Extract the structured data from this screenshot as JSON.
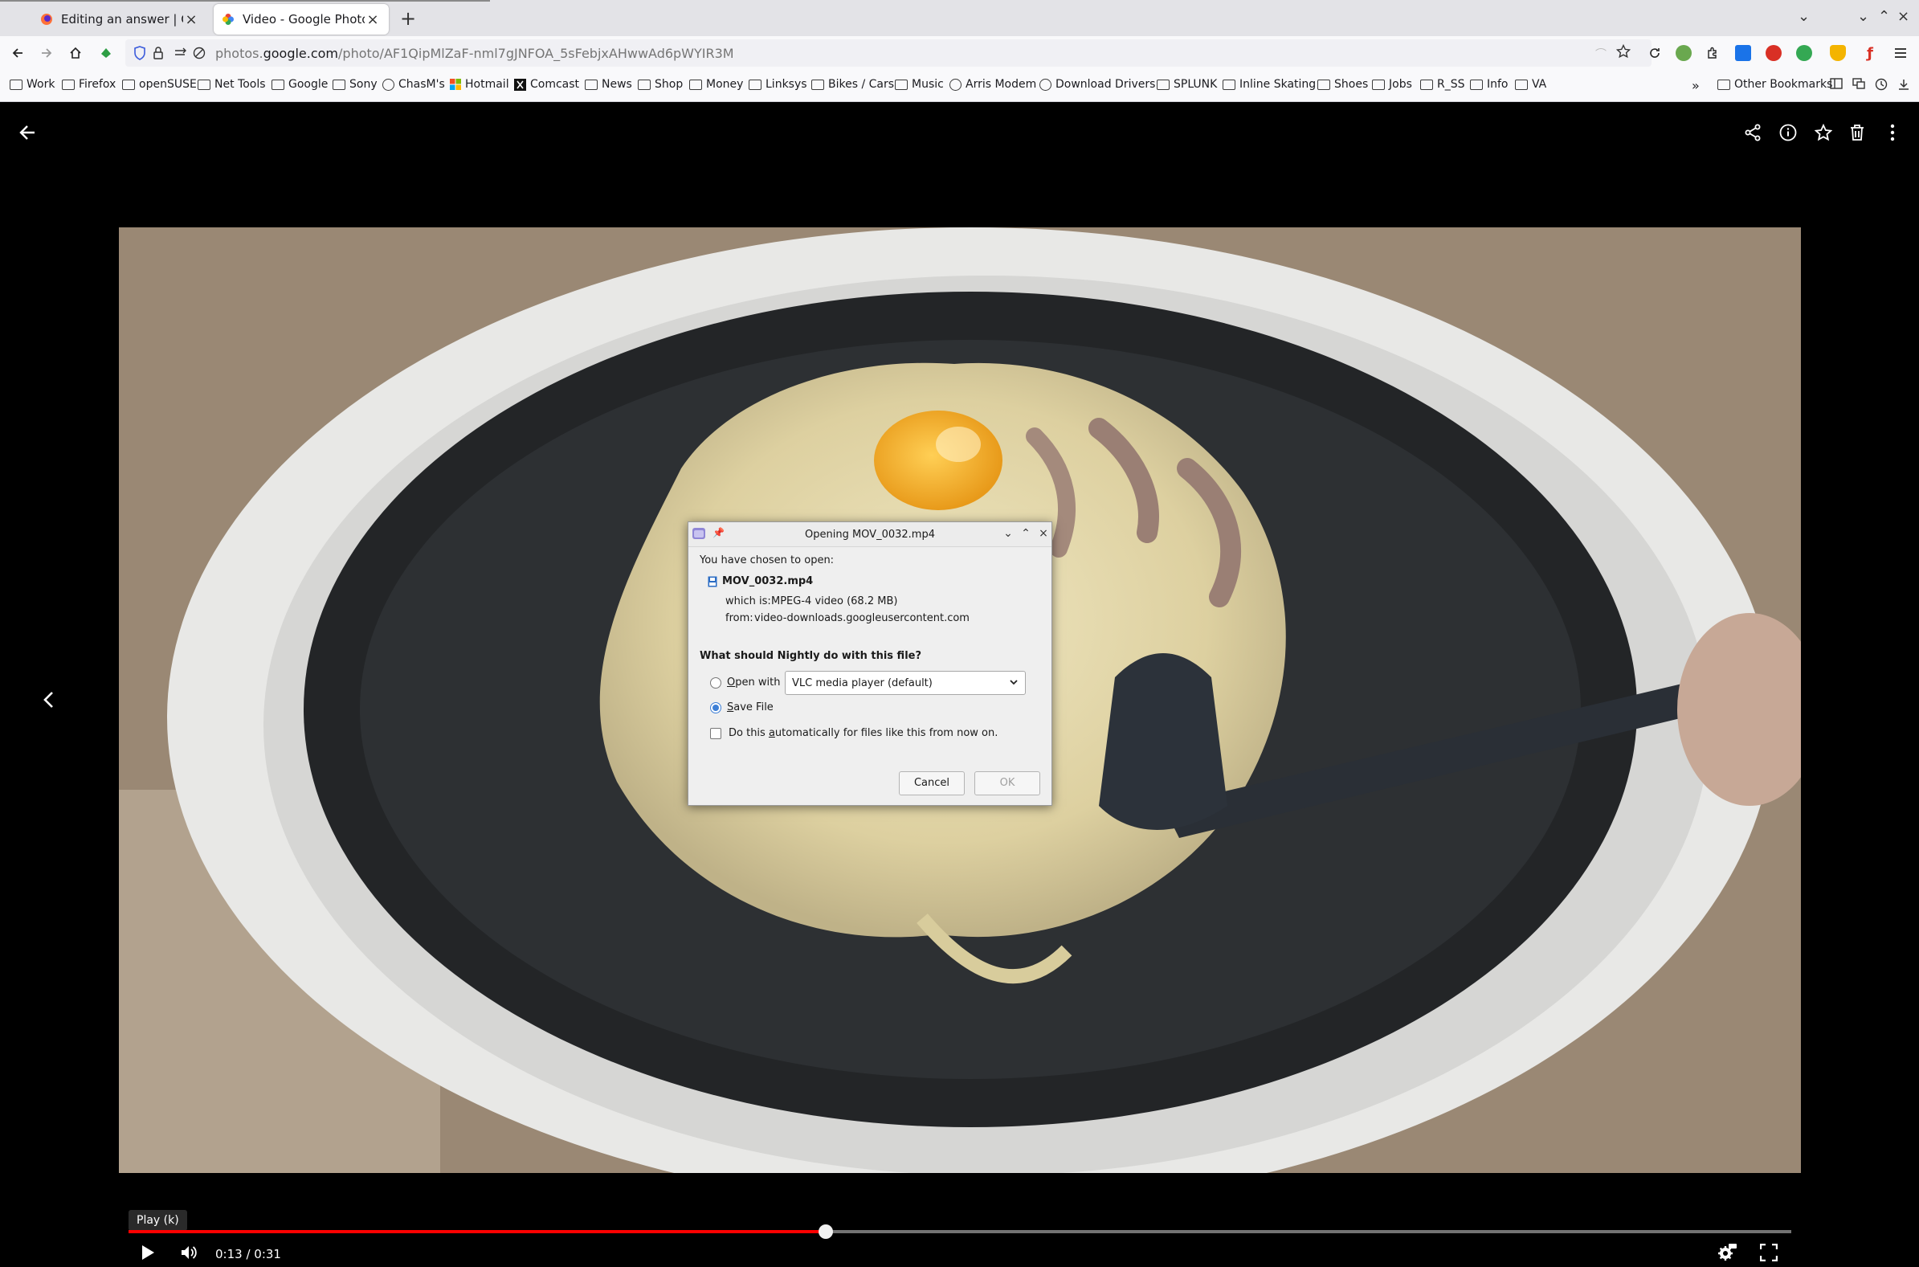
{
  "browser": {
    "tabs": [
      {
        "title": "Editing an answer | Can't d",
        "active": false
      },
      {
        "title": "Video - Google Photos",
        "active": true
      }
    ],
    "url": {
      "prefix": "photos.",
      "host": "google.com",
      "path": "/photo/AF1QipMlZaF-nml7gJNFOA_5sFebjxAHwwAd6pWYIR3M"
    },
    "bookmarks": [
      {
        "label": "Work",
        "icon": "folder-icon"
      },
      {
        "label": "Firefox",
        "icon": "folder-icon"
      },
      {
        "label": "openSUSE",
        "icon": "folder-icon"
      },
      {
        "label": "Net Tools",
        "icon": "folder-icon"
      },
      {
        "label": "Google",
        "icon": "folder-icon"
      },
      {
        "label": "Sony",
        "icon": "folder-icon"
      },
      {
        "label": "ChasM's",
        "icon": "globe-icon"
      },
      {
        "label": "Hotmail",
        "icon": "microsoft-icon"
      },
      {
        "label": "Comcast",
        "icon": "x-icon"
      },
      {
        "label": "News",
        "icon": "folder-icon"
      },
      {
        "label": "Shop",
        "icon": "folder-icon"
      },
      {
        "label": "Money",
        "icon": "folder-icon"
      },
      {
        "label": "Linksys",
        "icon": "folder-icon"
      },
      {
        "label": "Bikes / Cars",
        "icon": "folder-icon"
      },
      {
        "label": "Music",
        "icon": "folder-icon"
      },
      {
        "label": "Arris Modem",
        "icon": "globe-icon"
      },
      {
        "label": "Download Drivers",
        "icon": "globe-icon"
      },
      {
        "label": "SPLUNK",
        "icon": "folder-icon"
      },
      {
        "label": "Inline Skating",
        "icon": "folder-icon"
      },
      {
        "label": "Shoes",
        "icon": "folder-icon"
      },
      {
        "label": "Jobs",
        "icon": "folder-icon"
      },
      {
        "label": "R_SS",
        "icon": "folder-icon"
      },
      {
        "label": "Info",
        "icon": "folder-icon"
      },
      {
        "label": "VA",
        "icon": "folder-icon"
      }
    ],
    "other_bookmarks": "Other Bookmarks"
  },
  "player": {
    "tooltip": "Play (k)",
    "time": "0:13 / 0:31",
    "progress_fraction": 0.4194
  },
  "dialog": {
    "title": "Opening MOV_0032.mp4",
    "intro": "You have chosen to open:",
    "filename": "MOV_0032.mp4",
    "which_is_label": "which is:",
    "which_is_value": "MPEG-4 video (68.2 MB)",
    "from_label": "from:",
    "from_value": "video-downloads.googleusercontent.com",
    "question": "What should Nightly do with this file?",
    "open_with_key": "O",
    "open_with_rest": "pen with",
    "open_with_app": "VLC media player (default)",
    "save_key": "S",
    "save_rest": "ave File",
    "auto_pre": "Do this ",
    "auto_key": "a",
    "auto_rest": "utomatically for files like this from now on.",
    "cancel": "Cancel",
    "ok": "OK",
    "selected": "save"
  },
  "colors": {
    "progress": "#ff0000",
    "radio_accent": "#3d7fd6"
  }
}
